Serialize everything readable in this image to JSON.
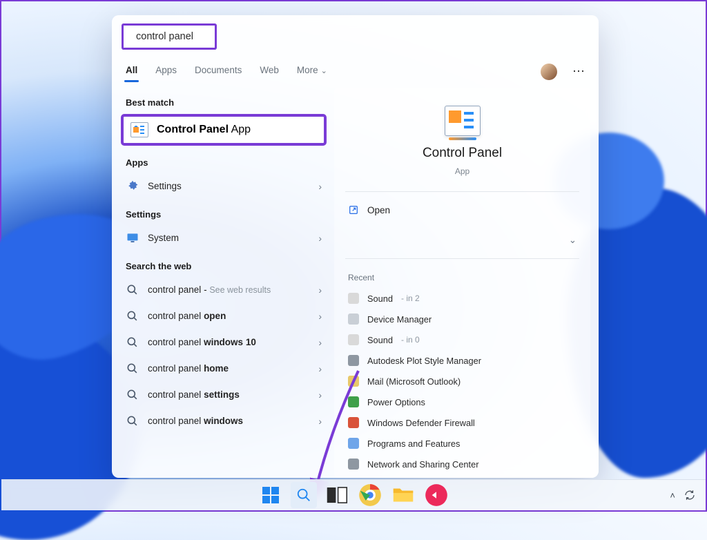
{
  "search": {
    "value": "control panel"
  },
  "tabs": {
    "all": "All",
    "apps": "Apps",
    "documents": "Documents",
    "web": "Web",
    "more": "More"
  },
  "sections": {
    "best_match": "Best match",
    "apps": "Apps",
    "settings": "Settings",
    "search_web": "Search the web"
  },
  "best": {
    "title": "Control Panel",
    "subtitle": "App"
  },
  "apps_list": [
    {
      "label": "Settings"
    }
  ],
  "settings_list": [
    {
      "label": "System"
    }
  ],
  "web_list": [
    {
      "label": "control panel",
      "hint": "See web results"
    },
    {
      "label_pre": "control panel ",
      "label_bold": "open"
    },
    {
      "label_pre": "control panel ",
      "label_bold": "windows 10"
    },
    {
      "label_pre": "control panel ",
      "label_bold": "home"
    },
    {
      "label_pre": "control panel ",
      "label_bold": "settings"
    },
    {
      "label_pre": "control panel ",
      "label_bold": "windows"
    }
  ],
  "preview": {
    "title": "Control Panel",
    "subtitle": "App",
    "open": "Open",
    "recent_label": "Recent",
    "recent": [
      {
        "label": "Sound",
        "hint": "in 2",
        "color": "#d9d9d9"
      },
      {
        "label": "Device Manager",
        "color": "#c9cfd6"
      },
      {
        "label": "Sound",
        "hint": "in 0",
        "color": "#d9d9d9"
      },
      {
        "label": "Autodesk Plot Style Manager",
        "color": "#8e97a1"
      },
      {
        "label": "Mail (Microsoft Outlook)",
        "color": "#e8c86a"
      },
      {
        "label": "Power Options",
        "color": "#3fa04a"
      },
      {
        "label": "Windows Defender Firewall",
        "color": "#d9533a"
      },
      {
        "label": "Programs and Features",
        "color": "#6fa5e9"
      },
      {
        "label": "Network and Sharing Center",
        "color": "#8e97a1"
      }
    ]
  }
}
